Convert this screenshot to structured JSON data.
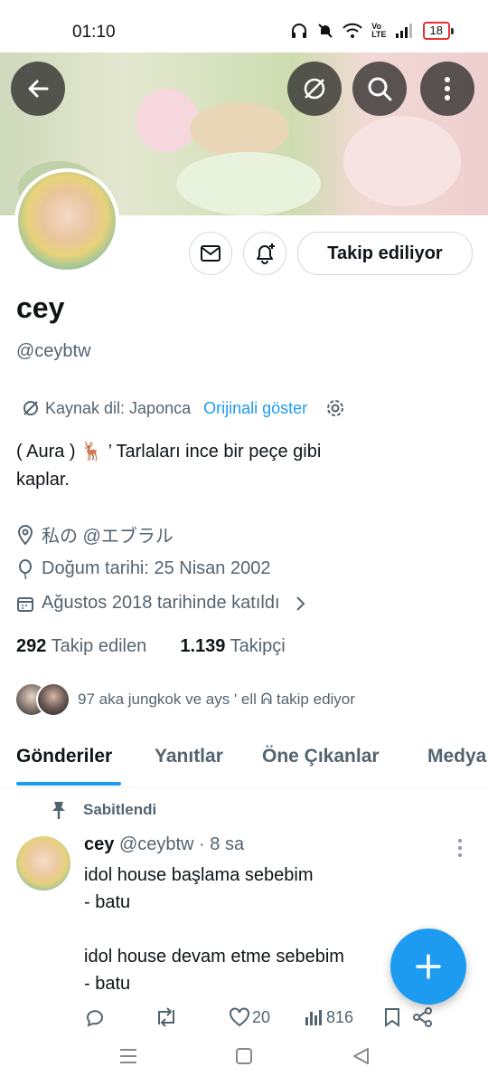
{
  "status_bar": {
    "time": "01:10",
    "battery": "18"
  },
  "profile": {
    "name": "cey",
    "handle": "@ceybtw",
    "follow_button": "Takip ediliyor",
    "translation": {
      "source": "Kaynak dil: Japonca",
      "show_original": "Orijinali göster"
    },
    "bio_line1": "( Aura )     🦌      ’  Tarlaları ince bir peçe gibi",
    "bio_line2": "kaplar.",
    "location": "私の @エブラル",
    "birthday": "Doğum tarihi: 25 Nisan 2002",
    "joined": "Ağustos 2018 tarihinde katıldı",
    "following_count": "292",
    "following_label": "Takip edilen",
    "followers_count": "1.139",
    "followers_label": "Takipçi",
    "followed_by": "97 aka jungkok ve ays ' ell ᕱ takip ediyor"
  },
  "tabs": [
    "Gönderiler",
    "Yanıtlar",
    "Öne Çıkanlar",
    "Medya"
  ],
  "post": {
    "pinned_label": "Sabitlendi",
    "name": "cey",
    "handle_time": "@ceybtw · 8 sa",
    "text": "idol house başlama sebebim\n- batu\n\nidol house devam etme sebebim\n- batu",
    "likes": "20",
    "views": "816"
  },
  "colors": {
    "accent": "#1d9bf0",
    "text": "#0f1419",
    "muted": "#536471"
  }
}
